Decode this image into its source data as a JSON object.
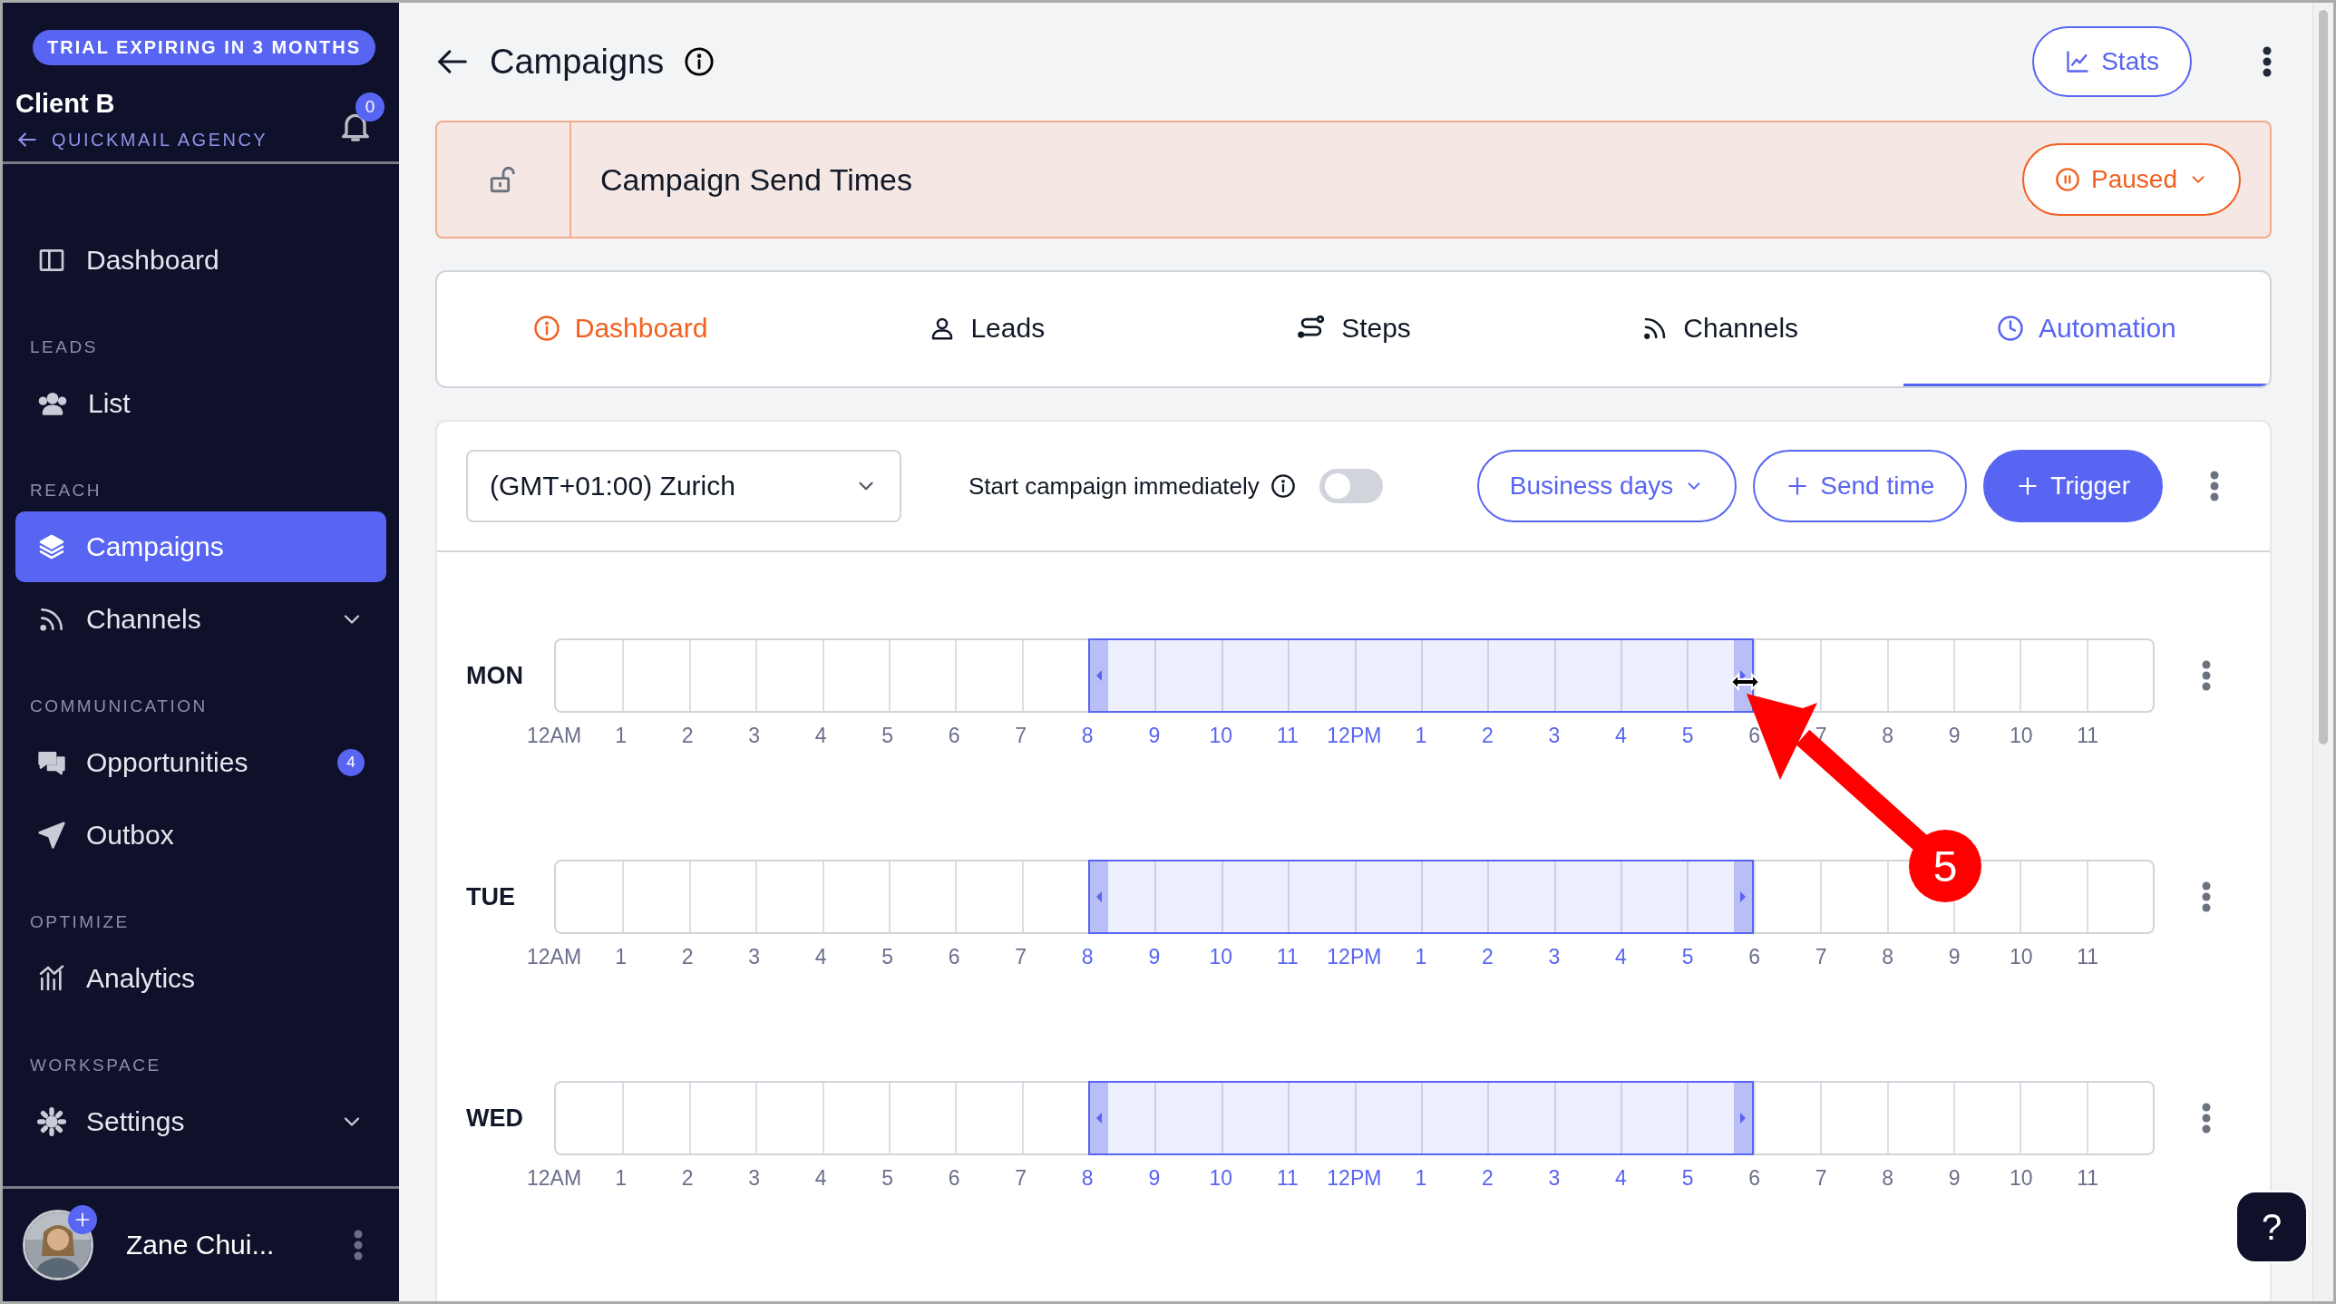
{
  "sidebar": {
    "trial_badge": "TRIAL EXPIRING IN 3 MONTHS",
    "client_name": "Client B",
    "agency_link": "QUICKMAIL AGENCY",
    "notification_count": "0",
    "sections": [
      {
        "items": [
          {
            "label": "Dashboard",
            "selected": false,
            "expandable": false
          }
        ]
      },
      {
        "heading": "LEADS",
        "items": [
          {
            "label": "List",
            "selected": false,
            "expandable": false
          }
        ]
      },
      {
        "heading": "REACH",
        "items": [
          {
            "label": "Campaigns",
            "selected": true,
            "expandable": false
          },
          {
            "label": "Channels",
            "selected": false,
            "expandable": true
          }
        ]
      },
      {
        "heading": "COMMUNICATION",
        "items": [
          {
            "label": "Opportunities",
            "selected": false,
            "expandable": false,
            "badge": "4"
          },
          {
            "label": "Outbox",
            "selected": false,
            "expandable": false
          }
        ]
      },
      {
        "heading": "OPTIMIZE",
        "items": [
          {
            "label": "Analytics",
            "selected": false,
            "expandable": false
          }
        ]
      },
      {
        "heading": "WORKSPACE",
        "items": [
          {
            "label": "Settings",
            "selected": false,
            "expandable": true
          }
        ]
      }
    ],
    "user": {
      "name": "Zane Chui..."
    }
  },
  "header": {
    "title": "Campaigns",
    "stats_button": "Stats"
  },
  "banner": {
    "title": "Campaign Send Times",
    "status": "Paused"
  },
  "tabs": [
    {
      "label": "Dashboard",
      "selected": false,
      "warning": true
    },
    {
      "label": "Leads",
      "selected": false,
      "warning": false
    },
    {
      "label": "Steps",
      "selected": false,
      "warning": false
    },
    {
      "label": "Channels",
      "selected": false,
      "warning": false
    },
    {
      "label": "Automation",
      "selected": true,
      "warning": false
    }
  ],
  "toolbar": {
    "timezone": "(GMT+01:00) Zurich",
    "start_immediately": {
      "label": "Start campaign immediately",
      "on": false
    },
    "business_days_button": "Business days",
    "send_time_button": "Send time",
    "trigger_button": "Trigger"
  },
  "schedule": [
    {
      "day": "MON",
      "hours": [
        {
          "label": "12AM",
          "active": false
        },
        {
          "label": "1",
          "active": false
        },
        {
          "label": "2",
          "active": false
        },
        {
          "label": "3",
          "active": false
        },
        {
          "label": "4",
          "active": false
        },
        {
          "label": "5",
          "active": false
        },
        {
          "label": "6",
          "active": false
        },
        {
          "label": "7",
          "active": false
        },
        {
          "label": "8",
          "active": true
        },
        {
          "label": "9",
          "active": true
        },
        {
          "label": "10",
          "active": true
        },
        {
          "label": "11",
          "active": true
        },
        {
          "label": "12PM",
          "active": true
        },
        {
          "label": "1",
          "active": true
        },
        {
          "label": "2",
          "active": true
        },
        {
          "label": "3",
          "active": true
        },
        {
          "label": "4",
          "active": true
        },
        {
          "label": "5",
          "active": true
        },
        {
          "label": "6",
          "active": false
        },
        {
          "label": "7",
          "active": false
        },
        {
          "label": "8",
          "active": false
        },
        {
          "label": "9",
          "active": false
        },
        {
          "label": "10",
          "active": false
        },
        {
          "label": "11",
          "active": false
        }
      ]
    },
    {
      "day": "TUE",
      "hours": [
        {
          "label": "12AM",
          "active": false
        },
        {
          "label": "1",
          "active": false
        },
        {
          "label": "2",
          "active": false
        },
        {
          "label": "3",
          "active": false
        },
        {
          "label": "4",
          "active": false
        },
        {
          "label": "5",
          "active": false
        },
        {
          "label": "6",
          "active": false
        },
        {
          "label": "7",
          "active": false
        },
        {
          "label": "8",
          "active": true
        },
        {
          "label": "9",
          "active": true
        },
        {
          "label": "10",
          "active": true
        },
        {
          "label": "11",
          "active": true
        },
        {
          "label": "12PM",
          "active": true
        },
        {
          "label": "1",
          "active": true
        },
        {
          "label": "2",
          "active": true
        },
        {
          "label": "3",
          "active": true
        },
        {
          "label": "4",
          "active": true
        },
        {
          "label": "5",
          "active": true
        },
        {
          "label": "6",
          "active": false
        },
        {
          "label": "7",
          "active": false
        },
        {
          "label": "8",
          "active": false
        },
        {
          "label": "9",
          "active": false
        },
        {
          "label": "10",
          "active": false
        },
        {
          "label": "11",
          "active": false
        }
      ]
    },
    {
      "day": "WED",
      "hours": [
        {
          "label": "12AM",
          "active": false
        },
        {
          "label": "1",
          "active": false
        },
        {
          "label": "2",
          "active": false
        },
        {
          "label": "3",
          "active": false
        },
        {
          "label": "4",
          "active": false
        },
        {
          "label": "5",
          "active": false
        },
        {
          "label": "6",
          "active": false
        },
        {
          "label": "7",
          "active": false
        },
        {
          "label": "8",
          "active": true
        },
        {
          "label": "9",
          "active": true
        },
        {
          "label": "10",
          "active": true
        },
        {
          "label": "11",
          "active": true
        },
        {
          "label": "12PM",
          "active": true
        },
        {
          "label": "1",
          "active": true
        },
        {
          "label": "2",
          "active": true
        },
        {
          "label": "3",
          "active": true
        },
        {
          "label": "4",
          "active": true
        },
        {
          "label": "5",
          "active": true
        },
        {
          "label": "6",
          "active": false
        },
        {
          "label": "7",
          "active": false
        },
        {
          "label": "8",
          "active": false
        },
        {
          "label": "9",
          "active": false
        },
        {
          "label": "10",
          "active": false
        },
        {
          "label": "11",
          "active": false
        }
      ]
    }
  ],
  "annotation": {
    "label": "5"
  },
  "help_button": "?"
}
